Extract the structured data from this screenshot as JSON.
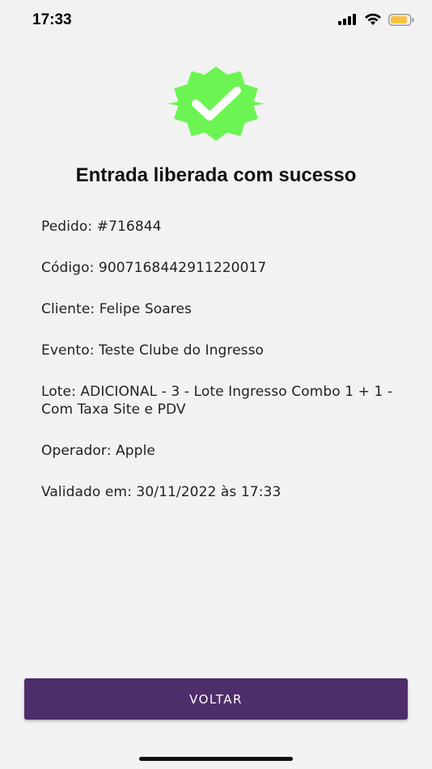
{
  "status_bar": {
    "time": "17:33",
    "icons": [
      "cellular-signal-icon",
      "wifi-icon",
      "battery-icon"
    ],
    "battery_color": "#f5c242"
  },
  "success": {
    "icon": "verified-checkmark-badge-icon",
    "icon_color": "#6cf552",
    "title": "Entrada liberada com sucesso"
  },
  "details": {
    "pedido": "Pedido: #716844",
    "codigo": "Código: 9007168442911220017",
    "cliente": "Cliente: Felipe Soares",
    "evento": "Evento: Teste Clube do Ingresso",
    "lote": "Lote: ADICIONAL - 3 - Lote Ingresso Combo 1 + 1 - Com Taxa Site e PDV",
    "operador": "Operador: Apple",
    "validado": "Validado em: 30/11/2022 às 17:33"
  },
  "actions": {
    "back_label": "VOLTAR",
    "button_color": "#4e2d6b"
  }
}
